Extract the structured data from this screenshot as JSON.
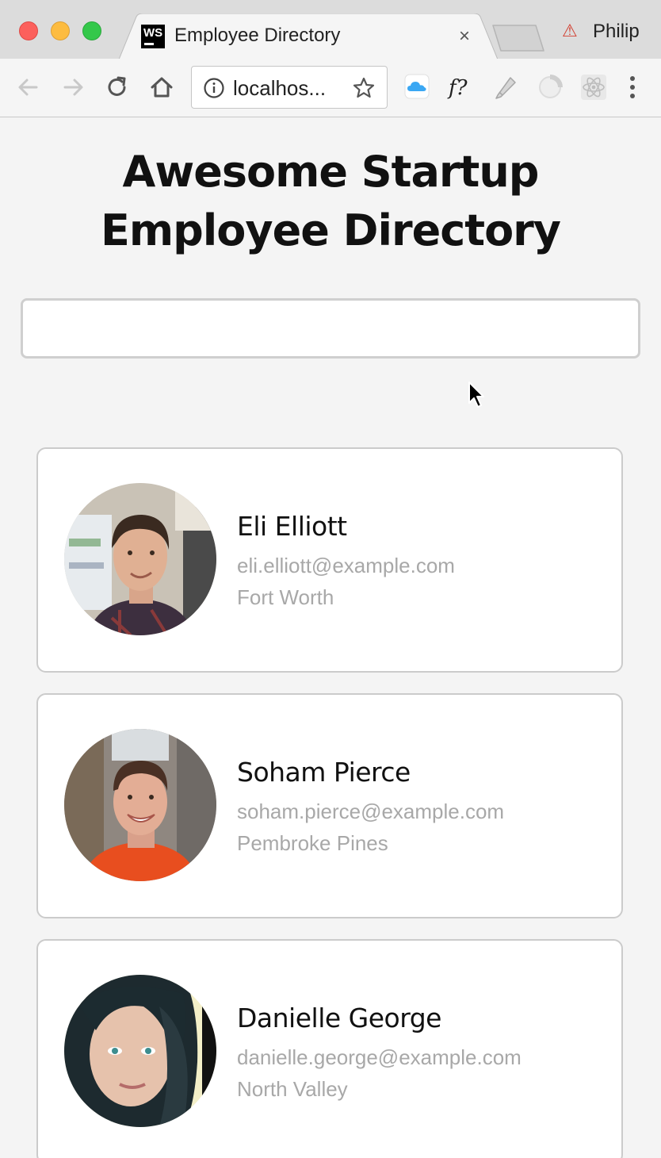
{
  "browser": {
    "tab_title": "Employee Directory",
    "tab_close": "×",
    "profile_name": "Philip",
    "profile_badge": "⚠",
    "url": "localhos...",
    "favicon_text": "WS"
  },
  "page": {
    "title": "Awesome Startup Employee Directory",
    "search": {
      "value": "",
      "placeholder": ""
    }
  },
  "employees": [
    {
      "name": "Eli Elliott",
      "email": "eli.elliott@example.com",
      "city": "Fort Worth"
    },
    {
      "name": "Soham Pierce",
      "email": "soham.pierce@example.com",
      "city": "Pembroke Pines"
    },
    {
      "name": "Danielle George",
      "email": "danielle.george@example.com",
      "city": "North Valley"
    }
  ],
  "icons": {
    "back": "arrow-left-icon",
    "forward": "arrow-right-icon",
    "reload": "reload-icon",
    "home": "home-icon",
    "info": "info-icon",
    "bookmark": "star-icon",
    "menu": "kebab-menu-icon"
  }
}
